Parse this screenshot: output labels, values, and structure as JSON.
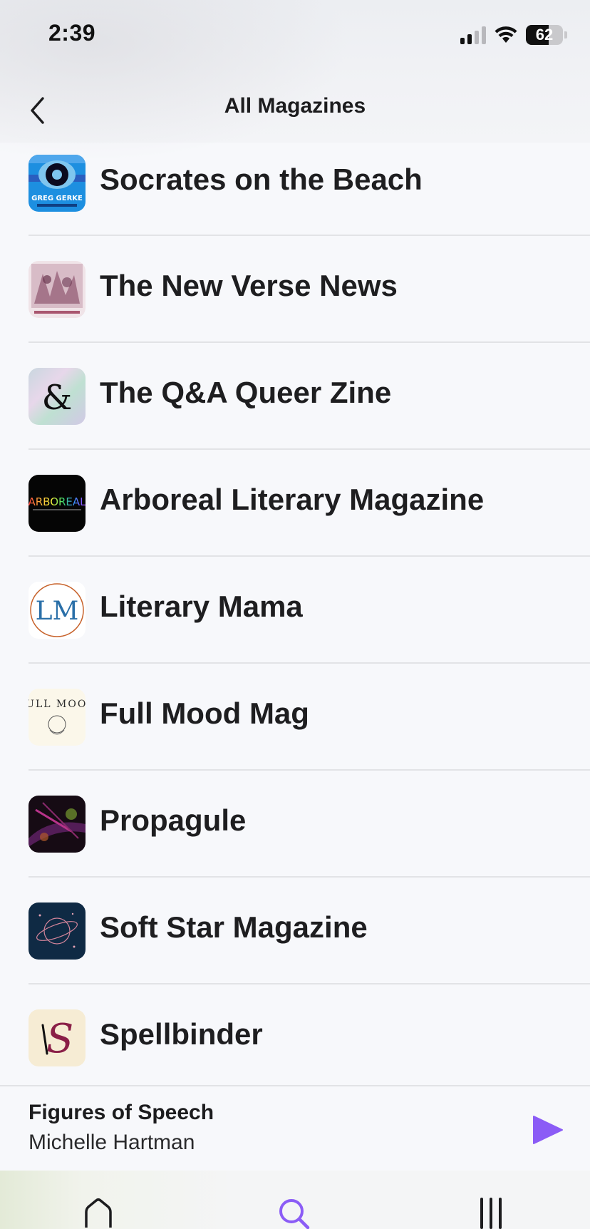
{
  "status_bar": {
    "time": "2:39",
    "battery": "62"
  },
  "nav": {
    "title": "All Magazines"
  },
  "magazines": [
    {
      "title": "Socrates on the Beach",
      "thumb_text": "GREG GERKE"
    },
    {
      "title": "The New Verse News"
    },
    {
      "title": "The Q&A Queer Zine",
      "thumb_text": "&"
    },
    {
      "title": "Arboreal Literary Magazine",
      "thumb_text": "ARBOREAL"
    },
    {
      "title": "Literary Mama",
      "thumb_text": "LM"
    },
    {
      "title": "Full Mood Mag",
      "thumb_text": "FULL MOOD"
    },
    {
      "title": "Propagule"
    },
    {
      "title": "Soft Star Magazine"
    },
    {
      "title": "Spellbinder",
      "thumb_text": "S"
    }
  ],
  "now_playing": {
    "title": "Figures of Speech",
    "artist": "Michelle Hartman"
  },
  "colors": {
    "accent": "#8b5cf6",
    "text": "#1e1e20",
    "divider": "#e2e3e6"
  },
  "tabs": [
    {
      "icon": "home-icon"
    },
    {
      "icon": "search-icon",
      "active": true
    },
    {
      "icon": "library-icon"
    }
  ]
}
